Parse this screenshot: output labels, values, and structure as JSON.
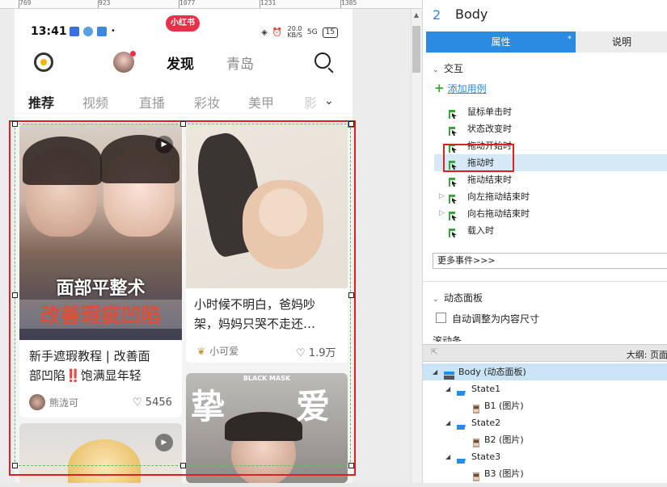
{
  "ruler": {
    "marks": [
      "769",
      "923",
      "1077",
      "1231",
      "1385"
    ]
  },
  "status_bar": {
    "time": "13:41",
    "net_speed": "20.0",
    "net_unit": "KB/S",
    "signal": "5G",
    "battery": "15"
  },
  "app_badge": "小红书",
  "top_nav": {
    "discover": "发现",
    "qingdao": "青岛"
  },
  "category_tabs": [
    "推荐",
    "视频",
    "直播",
    "彩妆",
    "美甲",
    "影"
  ],
  "feed": {
    "card1": {
      "overlay_line1": "面部平整术",
      "overlay_line2": "改善瑕疵凹陷",
      "title_line1": "新手遮瑕教程 | 改善面",
      "title_line2a": "部凹陷",
      "title_mark": "‼️",
      "title_line2b": "饱满显年轻",
      "author": "熊泷可",
      "likes": "5456"
    },
    "card2": {
      "title_line1": "小时候不明白，爸妈吵",
      "title_line2": "架，妈妈只哭不走还…",
      "author": "小可爱",
      "likes": "1.9万"
    },
    "card4": {
      "watermark": "BLACK MASK",
      "overlay_left": "挚",
      "overlay_right": "爱"
    }
  },
  "selection": {
    "badge": "2"
  },
  "panel": {
    "number": "2",
    "title": "Body",
    "tab_properties": "属性",
    "tab_properties_star": "*",
    "tab_notes": "说明",
    "interaction_section": "交互",
    "add_case": "添加用例",
    "events": [
      {
        "label": "鼠标单击时",
        "expandable": false,
        "highlighted": false
      },
      {
        "label": "状态改变时",
        "expandable": false,
        "highlighted": false
      },
      {
        "label": "拖动开始时",
        "expandable": false,
        "highlighted": false
      },
      {
        "label": "拖动时",
        "expandable": false,
        "highlighted": true
      },
      {
        "label": "拖动结束时",
        "expandable": false,
        "highlighted": false
      },
      {
        "label": "向左拖动结束时",
        "expandable": true,
        "highlighted": false
      },
      {
        "label": "向右拖动结束时",
        "expandable": true,
        "highlighted": false
      },
      {
        "label": "载入时",
        "expandable": false,
        "highlighted": false
      }
    ],
    "more_events": "更多事件>>>",
    "dynamic_panel_section": "动态面板",
    "auto_fit_label": "自动调整为内容尺寸",
    "scroll_label": "滚动条",
    "outline_title": "大纲: 页面",
    "outline": [
      {
        "label": "Body (动态面板)",
        "level": 0,
        "highlighted": true,
        "kind": "panel"
      },
      {
        "label": "State1",
        "level": 1,
        "highlighted": false,
        "kind": "state"
      },
      {
        "label": "B1 (图片)",
        "level": 2,
        "highlighted": false,
        "kind": "image"
      },
      {
        "label": "State2",
        "level": 1,
        "highlighted": false,
        "kind": "state"
      },
      {
        "label": "B2 (图片)",
        "level": 2,
        "highlighted": false,
        "kind": "image"
      },
      {
        "label": "State3",
        "level": 1,
        "highlighted": false,
        "kind": "state"
      },
      {
        "label": "B3 (图片)",
        "level": 2,
        "highlighted": false,
        "kind": "image"
      }
    ]
  },
  "colors": {
    "accent": "#2b8ae2",
    "selection_red": "#e02020",
    "xhs_red": "#e9304a"
  }
}
